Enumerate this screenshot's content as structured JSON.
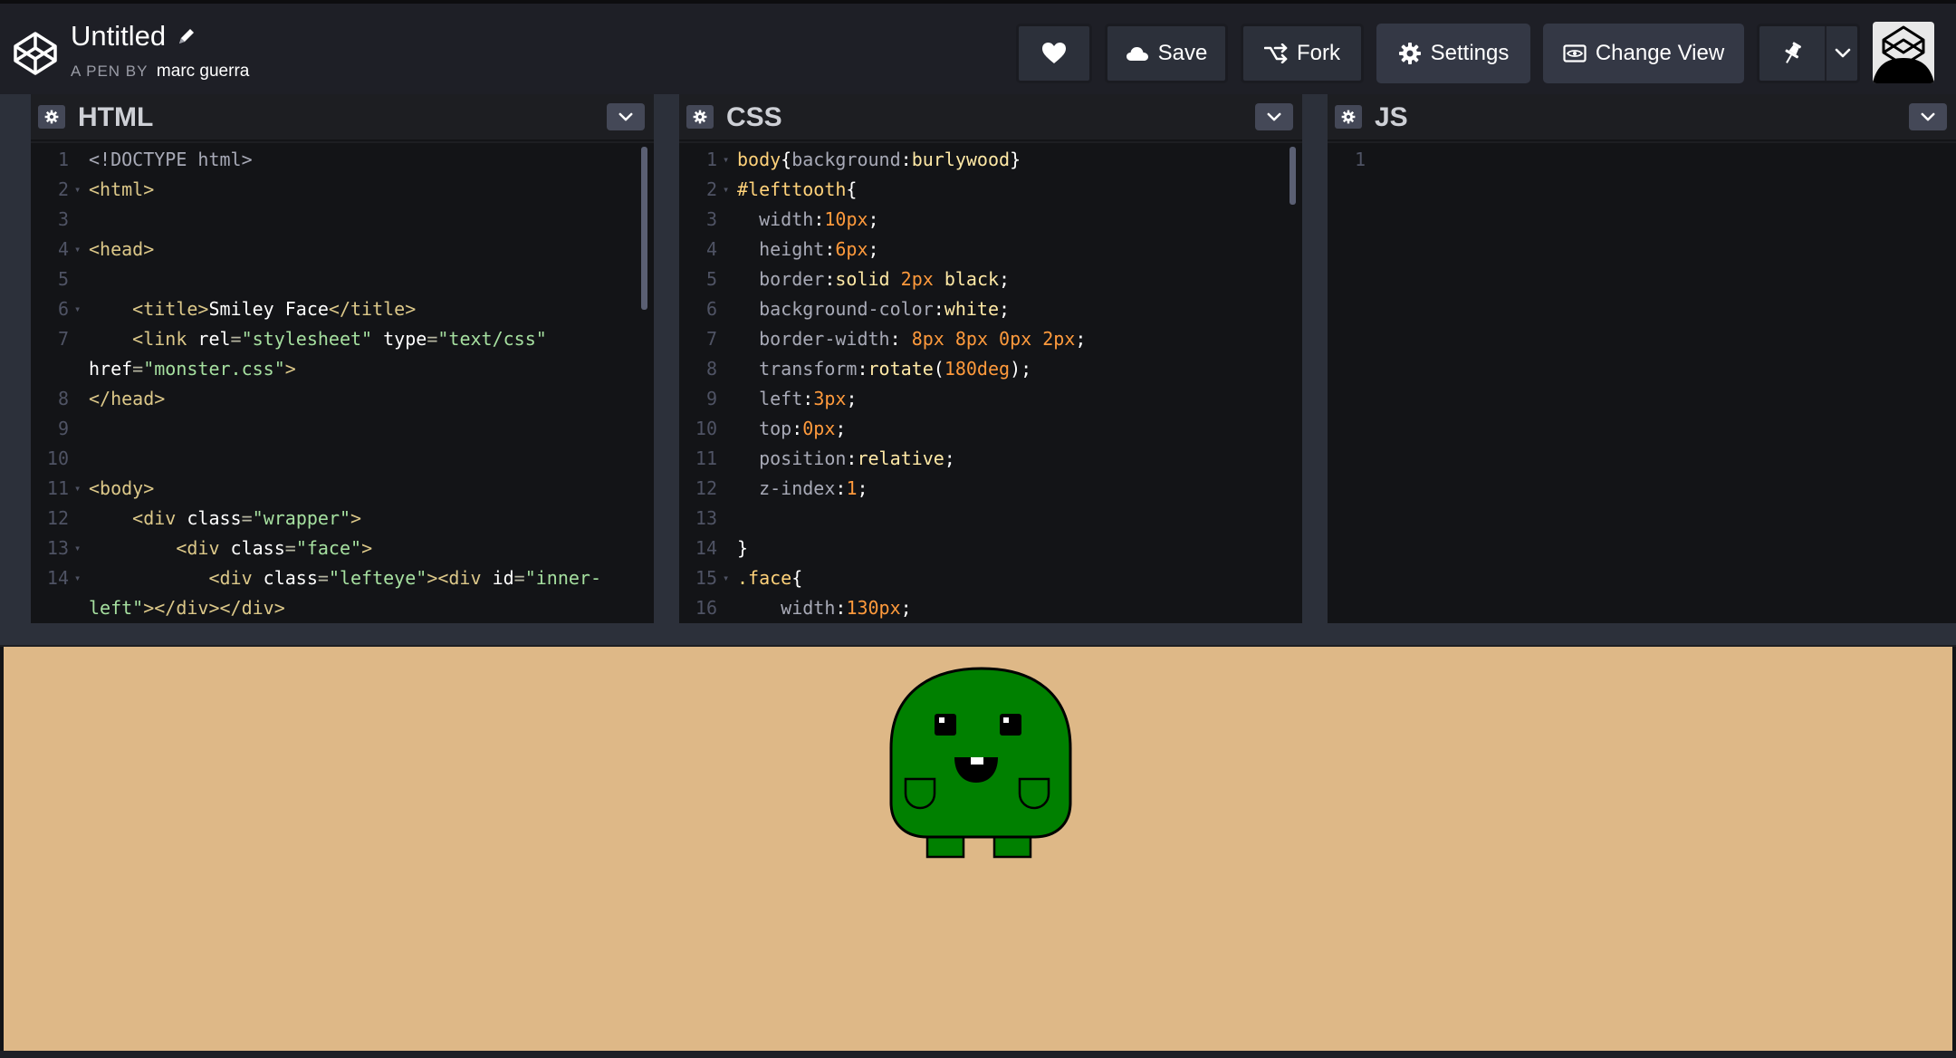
{
  "header": {
    "pen_title": "Untitled",
    "byline_prefix": "A PEN BY",
    "author": "marc guerra",
    "buttons": {
      "save": "Save",
      "fork": "Fork",
      "settings": "Settings",
      "change_view": "Change View"
    }
  },
  "editors": {
    "html": {
      "title": "HTML",
      "lines": [
        {
          "n": "1",
          "fold": false,
          "html": "<span class='t-doc'>&lt;!DOCTYPE html&gt;</span>"
        },
        {
          "n": "2",
          "fold": true,
          "html": "<span class='t-tagname'>&lt;html&gt;</span>"
        },
        {
          "n": "3",
          "fold": false,
          "html": ""
        },
        {
          "n": "4",
          "fold": true,
          "html": "<span class='t-tagname'>&lt;head&gt;</span>"
        },
        {
          "n": "5",
          "fold": false,
          "html": ""
        },
        {
          "n": "6",
          "fold": true,
          "html": "    <span class='t-tagname'>&lt;title&gt;</span><span class='t-txt'>Smiley Face</span><span class='t-tagname'>&lt;/title&gt;</span>"
        },
        {
          "n": "7",
          "fold": false,
          "html": "    <span class='t-tagname'>&lt;link </span><span class='t-attr'>rel</span><span class='t-tag'>=</span><span class='t-str'>\"stylesheet\"</span> <span class='t-attr'>type</span><span class='t-tag'>=</span><span class='t-str'>\"text/css\"</span>"
        },
        {
          "n": "",
          "fold": false,
          "html": "<span class='t-attr'>href</span><span class='t-tag'>=</span><span class='t-str'>\"monster.css\"</span><span class='t-tagname'>&gt;</span>"
        },
        {
          "n": "8",
          "fold": false,
          "html": "<span class='t-tagname'>&lt;/head&gt;</span>"
        },
        {
          "n": "9",
          "fold": false,
          "html": ""
        },
        {
          "n": "10",
          "fold": false,
          "html": ""
        },
        {
          "n": "11",
          "fold": true,
          "html": "<span class='t-tagname'>&lt;body&gt;</span>"
        },
        {
          "n": "12",
          "fold": false,
          "html": "    <span class='t-tagname'>&lt;div </span><span class='t-attr'>class</span><span class='t-tag'>=</span><span class='t-str'>\"wrapper\"</span><span class='t-tagname'>&gt;</span>"
        },
        {
          "n": "13",
          "fold": true,
          "html": "        <span class='t-tagname'>&lt;div </span><span class='t-attr'>class</span><span class='t-tag'>=</span><span class='t-str'>\"face\"</span><span class='t-tagname'>&gt;</span>"
        },
        {
          "n": "14",
          "fold": true,
          "html": "           <span class='t-tagname'>&lt;div </span><span class='t-attr'>class</span><span class='t-tag'>=</span><span class='t-str'>\"lefteye\"</span><span class='t-tagname'>&gt;&lt;div </span><span class='t-attr'>id</span><span class='t-tag'>=</span><span class='t-str'>\"inner-</span>"
        },
        {
          "n": "",
          "fold": false,
          "html": "<span class='t-str'>left\"</span><span class='t-tagname'>&gt;&lt;/div&gt;&lt;/div&gt;</span>"
        }
      ]
    },
    "css": {
      "title": "CSS",
      "lines": [
        {
          "n": "1",
          "fold": true,
          "html": "<span class='t-sel'>body</span><span class='t-punc'>{</span><span class='t-prop'>background</span><span class='t-punc'>:</span><span class='t-val'>burlywood</span><span class='t-punc'>}</span>"
        },
        {
          "n": "2",
          "fold": true,
          "html": "<span class='t-sel'>#lefttooth</span><span class='t-punc'>{</span>"
        },
        {
          "n": "3",
          "fold": false,
          "html": "  <span class='t-prop'>width</span><span class='t-punc'>:</span><span class='t-num'>10px</span><span class='t-punc'>;</span>"
        },
        {
          "n": "4",
          "fold": false,
          "html": "  <span class='t-prop'>height</span><span class='t-punc'>:</span><span class='t-num'>6px</span><span class='t-punc'>;</span>"
        },
        {
          "n": "5",
          "fold": false,
          "html": "  <span class='t-prop'>border</span><span class='t-punc'>:</span><span class='t-val'>solid</span> <span class='t-num'>2px</span> <span class='t-val'>black</span><span class='t-punc'>;</span>"
        },
        {
          "n": "6",
          "fold": false,
          "html": "  <span class='t-prop'>background-color</span><span class='t-punc'>:</span><span class='t-val'>white</span><span class='t-punc'>;</span>"
        },
        {
          "n": "7",
          "fold": false,
          "html": "  <span class='t-prop'>border-width</span><span class='t-punc'>:</span> <span class='t-num'>8px</span> <span class='t-num'>8px</span> <span class='t-num'>0px</span> <span class='t-num'>2px</span><span class='t-punc'>;</span>"
        },
        {
          "n": "8",
          "fold": false,
          "html": "  <span class='t-prop'>transform</span><span class='t-punc'>:</span><span class='t-val'>rotate</span><span class='t-punc'>(</span><span class='t-num'>180deg</span><span class='t-punc'>);</span>"
        },
        {
          "n": "9",
          "fold": false,
          "html": "  <span class='t-prop'>left</span><span class='t-punc'>:</span><span class='t-num'>3px</span><span class='t-punc'>;</span>"
        },
        {
          "n": "10",
          "fold": false,
          "html": "  <span class='t-prop'>top</span><span class='t-punc'>:</span><span class='t-num'>0px</span><span class='t-punc'>;</span>"
        },
        {
          "n": "11",
          "fold": false,
          "html": "  <span class='t-prop'>position</span><span class='t-punc'>:</span><span class='t-val'>relative</span><span class='t-punc'>;</span>"
        },
        {
          "n": "12",
          "fold": false,
          "html": "  <span class='t-prop'>z-index</span><span class='t-punc'>:</span><span class='t-num'>1</span><span class='t-punc'>;</span>"
        },
        {
          "n": "13",
          "fold": false,
          "html": ""
        },
        {
          "n": "14",
          "fold": false,
          "html": "<span class='t-punc'>}</span>"
        },
        {
          "n": "15",
          "fold": true,
          "html": "<span class='t-sel'>.face</span><span class='t-punc'>{</span>"
        },
        {
          "n": "16",
          "fold": false,
          "html": "    <span class='t-prop'>width</span><span class='t-punc'>:</span><span class='t-num'>130px</span><span class='t-punc'>;</span>"
        }
      ]
    },
    "js": {
      "title": "JS",
      "lines": [
        {
          "n": "1",
          "fold": false,
          "html": ""
        }
      ]
    }
  },
  "colors": {
    "preview_background": "#deb887",
    "monster_body": "#008000"
  },
  "icons": {
    "logo": "codepen-logo-icon",
    "edit": "pencil-icon",
    "heart": "heart-icon",
    "save": "cloud-icon",
    "fork": "fork-icon",
    "settings": "gear-icon",
    "change_view": "eye-box-icon",
    "pin": "pin-icon"
  }
}
